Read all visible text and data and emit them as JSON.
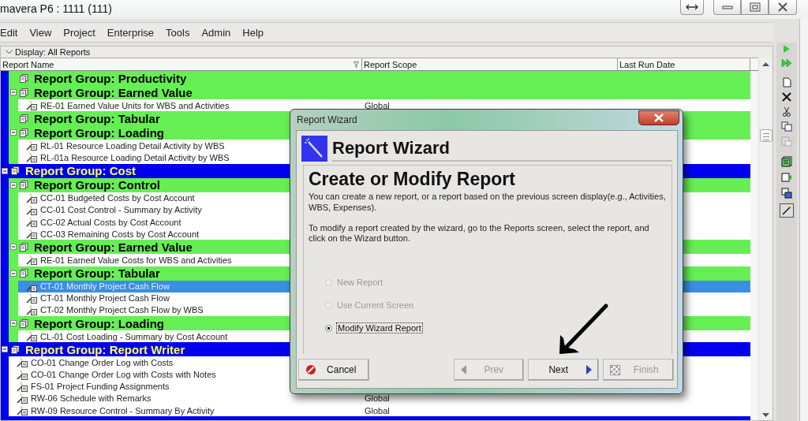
{
  "window": {
    "title": "mavera P6 : 1111 (111)"
  },
  "menu": [
    "Edit",
    "View",
    "Project",
    "Enterprise",
    "Tools",
    "Admin",
    "Help"
  ],
  "display_bar": {
    "label": "Display: All Reports"
  },
  "table": {
    "columns": [
      "Report Name",
      "Report Scope",
      "Last Run Date"
    ],
    "tree": [
      {
        "kind": "group",
        "children": [
          {
            "kind": "group",
            "label": "Report Group: Productivity",
            "expanded": false
          },
          {
            "kind": "group",
            "label": "Report Group: Earned Value",
            "expanded": true,
            "children": [
              {
                "kind": "report",
                "name": "RE-01 Earned Value Units for WBS and Activities",
                "scope": "Global",
                "selected": false
              }
            ]
          },
          {
            "kind": "group",
            "label": "Report Group: Tabular",
            "expanded": false
          },
          {
            "kind": "group",
            "label": "Report Group: Loading",
            "expanded": true,
            "children": [
              {
                "kind": "report",
                "name": "RL-01 Resource Loading Detail Activity by WBS",
                "selected": false
              },
              {
                "kind": "report",
                "name": "RL-01a Resource Loading Detail Activity by WBS",
                "selected": false
              }
            ]
          }
        ]
      },
      {
        "kind": "group",
        "label": "Report Group: Cost",
        "expanded": true,
        "children": [
          {
            "kind": "group",
            "label": "Report Group: Control",
            "expanded": true,
            "children": [
              {
                "kind": "report",
                "name": "CC-01 Budgeted Costs by Cost Account",
                "selected": false
              },
              {
                "kind": "report",
                "name": "CC-01 Cost Control - Summary by Activity",
                "selected": false
              },
              {
                "kind": "report",
                "name": "CC-02 Actual Costs by Cost Account",
                "selected": false
              },
              {
                "kind": "report",
                "name": "CC-03 Remaining Costs by Cost Account",
                "selected": false
              }
            ]
          },
          {
            "kind": "group",
            "label": "Report Group: Earned Value",
            "expanded": true,
            "children": [
              {
                "kind": "report",
                "name": "RE-01 Earned Value Costs for WBS and Activities",
                "selected": false
              }
            ]
          },
          {
            "kind": "group",
            "label": "Report Group: Tabular",
            "expanded": true,
            "children": [
              {
                "kind": "report",
                "name": "CT-01 Monthly Project Cash Flow",
                "selected": true
              },
              {
                "kind": "report",
                "name": "CT-01 Monthly Project Cash Flow",
                "selected": false
              },
              {
                "kind": "report",
                "name": "CT-02 Monthly Project Cash Flow by WBS",
                "selected": false
              }
            ]
          },
          {
            "kind": "group",
            "label": "Report Group: Loading",
            "expanded": true,
            "children": [
              {
                "kind": "report",
                "name": "CL-01 Cost Loading - Summary by Cost Account",
                "selected": false
              }
            ]
          }
        ]
      },
      {
        "kind": "group",
        "label": "Report Group: Report Writer",
        "expanded": true,
        "children": [
          {
            "kind": "report",
            "name": "CO-01 Change Order Log with Costs",
            "selected": false
          },
          {
            "kind": "report",
            "name": "CO-01 Change Order Log with Costs with Notes",
            "selected": false
          },
          {
            "kind": "report",
            "name": "FS-01 Project Funding Assignments",
            "selected": false
          },
          {
            "kind": "report",
            "name": "RW-06 Schedule with Remarks",
            "scope": "Global",
            "selected": false
          },
          {
            "kind": "report",
            "name": "RW-09 Resource Control - Summary By Activity",
            "scope": "Global",
            "selected": false
          }
        ]
      }
    ]
  },
  "dialog": {
    "title": "Report Wizard",
    "header": "Report Wizard",
    "heading": "Create or Modify Report",
    "paragraphs": [
      "You can create a new report, or a report based on the previous screen display(e.g., Activities, WBS, Expenses).",
      "To modify a report created by the wizard, go to the Reports screen, select the report, and click on the Wizard button."
    ],
    "options": [
      {
        "label": "New Report",
        "selected": false,
        "disabled": true
      },
      {
        "label": "Use Current Screen",
        "selected": false,
        "disabled": true
      },
      {
        "label": "Modify Wizard Report",
        "selected": true,
        "disabled": false
      }
    ],
    "buttons": [
      {
        "kind": "cancel",
        "label": "Cancel",
        "disabled": false
      },
      {
        "kind": "prev",
        "label": "Prev",
        "disabled": true
      },
      {
        "kind": "next",
        "label": "Next",
        "disabled": false
      },
      {
        "kind": "finish",
        "label": "Finish",
        "disabled": true
      }
    ]
  }
}
